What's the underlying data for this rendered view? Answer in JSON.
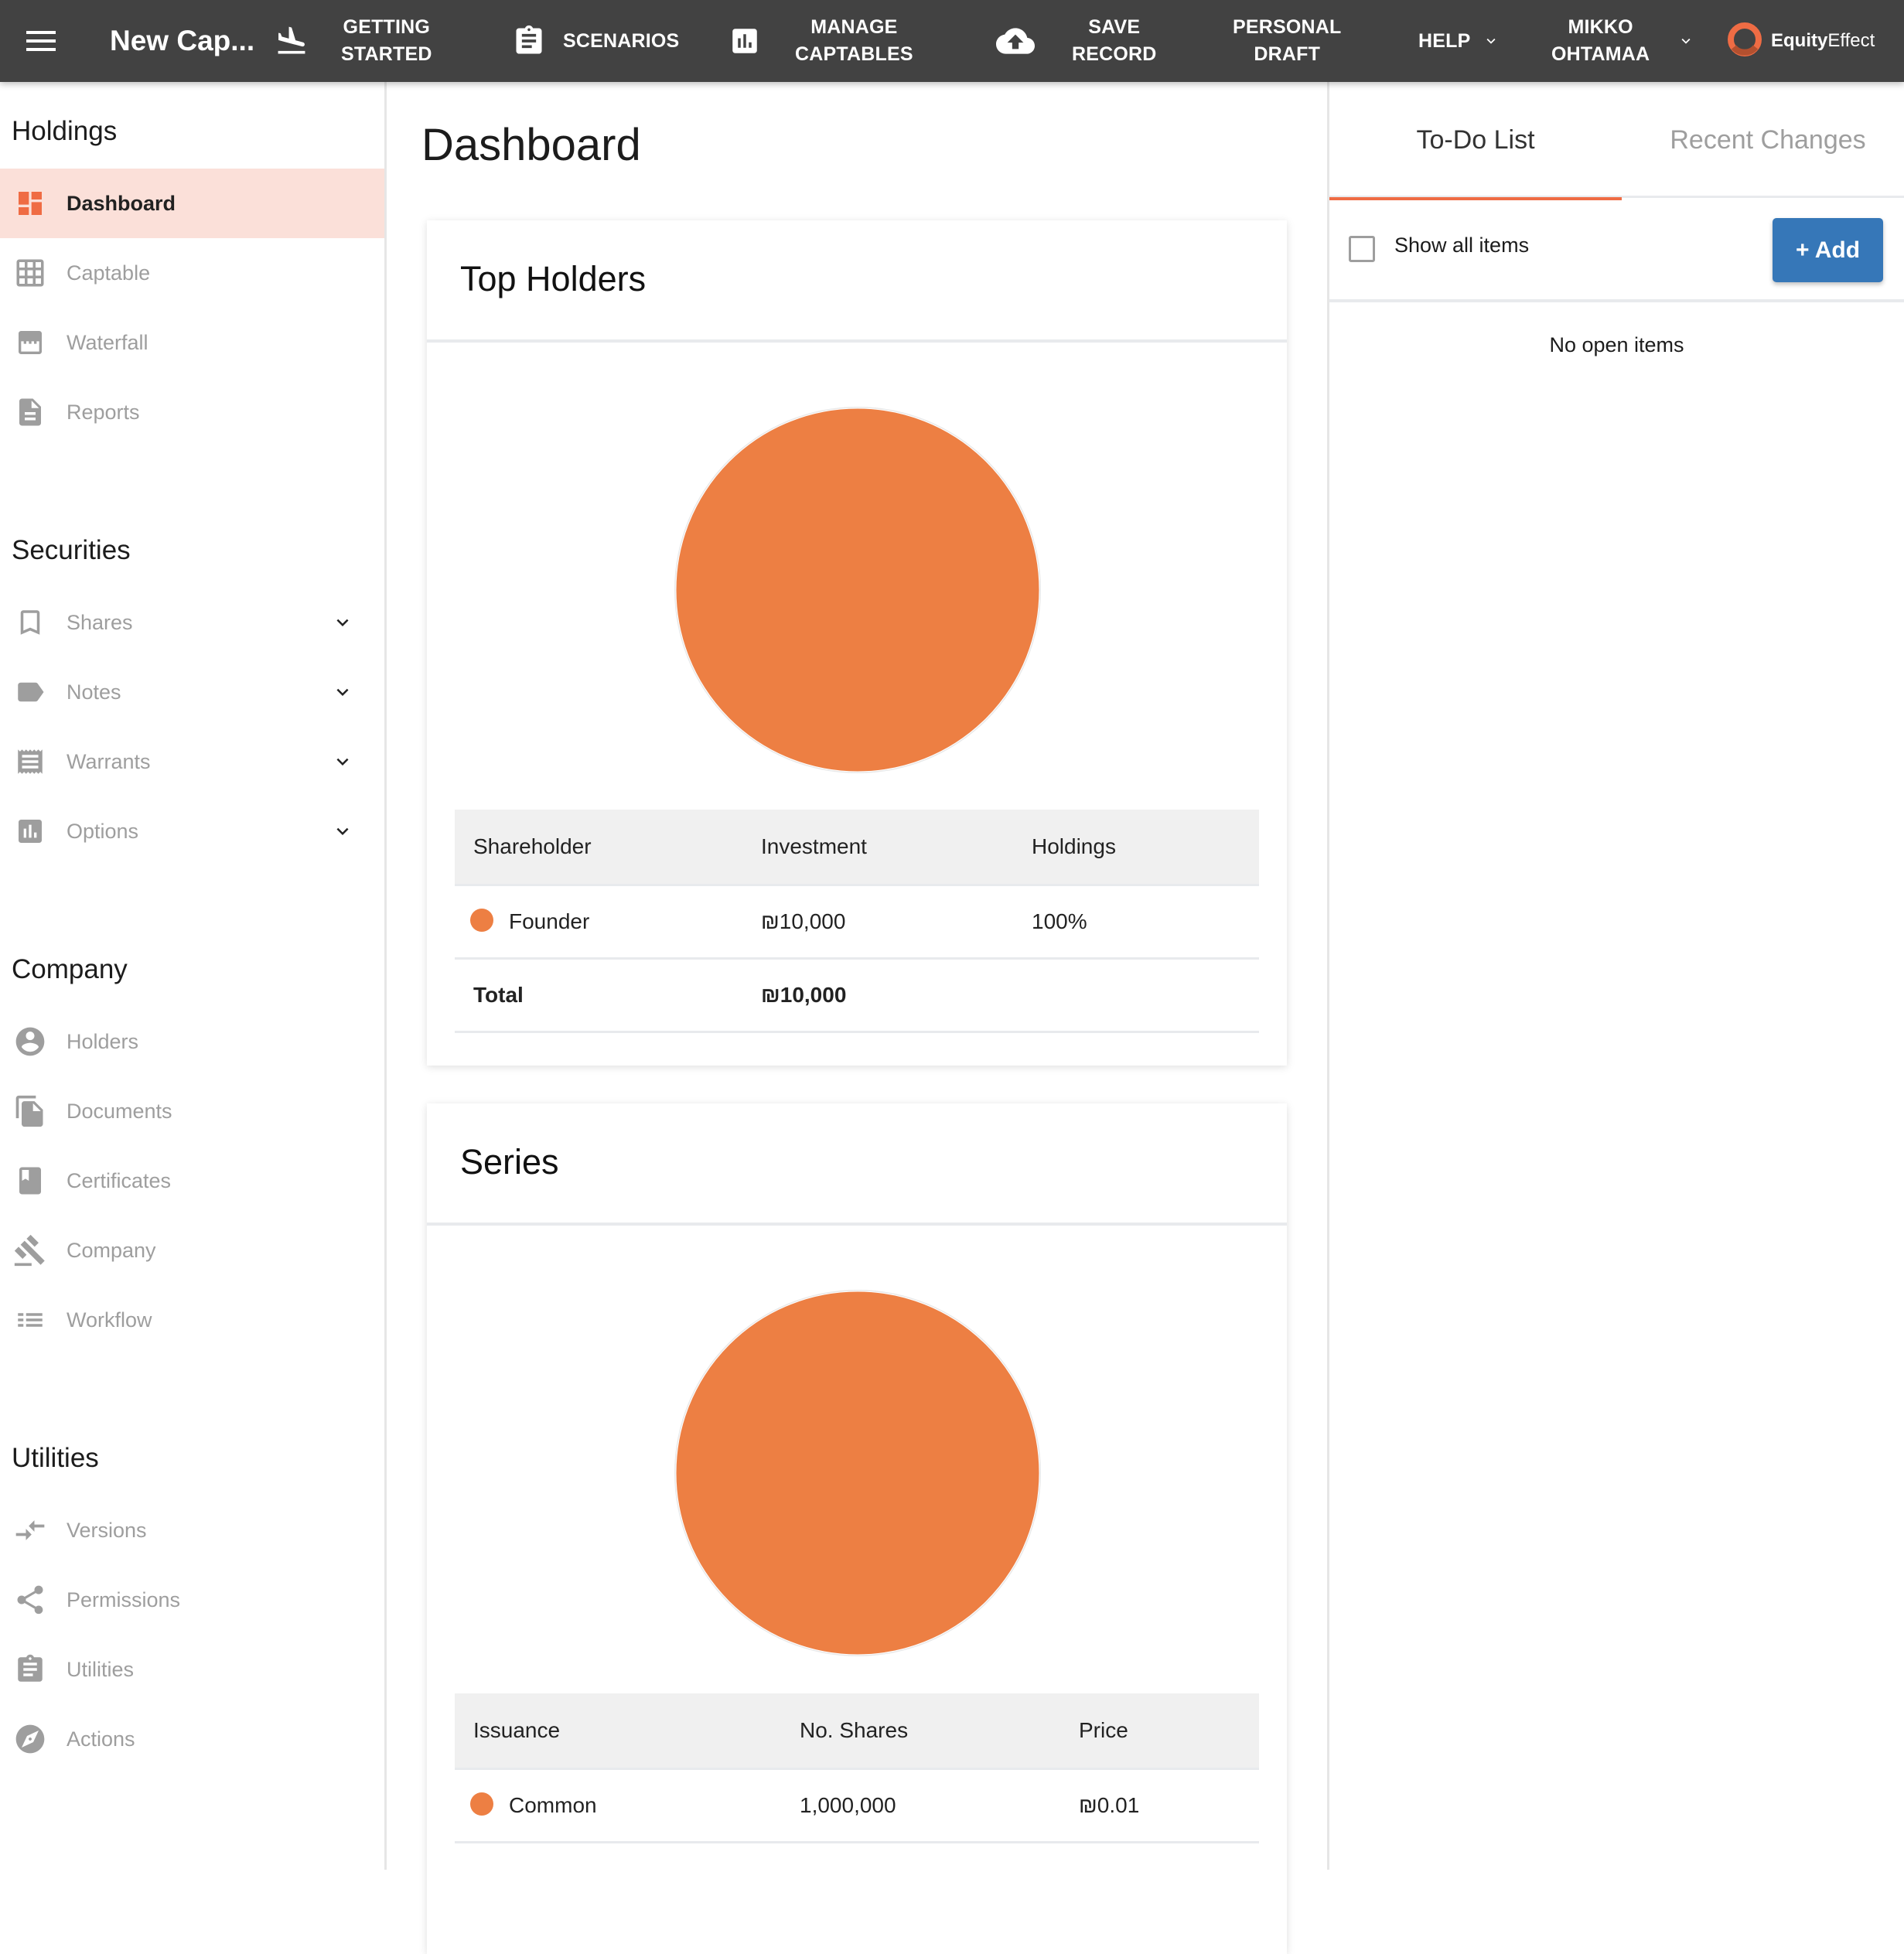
{
  "topbar": {
    "app_title": "New Cap...",
    "nav": [
      {
        "label": "GETTING\nSTARTED",
        "icon": "flight-land-icon"
      },
      {
        "label": "SCENARIOS",
        "icon": "clipboard-icon"
      },
      {
        "label": "MANAGE\nCAPTABLES",
        "icon": "bar-chart-icon"
      },
      {
        "label": "SAVE\nRECORD",
        "icon": "cloud-upload-icon"
      },
      {
        "label": "PERSONAL\nDRAFT"
      },
      {
        "label": "HELP",
        "icon": "chevron-down-icon"
      },
      {
        "label": "MIKKO\nOHTAMAA",
        "icon": "chevron-down-icon"
      }
    ],
    "logo": {
      "bold": "Equity",
      "light": "Effect",
      "color": "#ef6c44"
    }
  },
  "sidebar": {
    "sections": [
      {
        "title": "Holdings",
        "items": [
          {
            "label": "Dashboard",
            "icon": "dashboard-icon",
            "active": true
          },
          {
            "label": "Captable",
            "icon": "grid-icon"
          },
          {
            "label": "Waterfall",
            "icon": "waterfall-icon"
          },
          {
            "label": "Reports",
            "icon": "document-icon"
          }
        ]
      },
      {
        "title": "Securities",
        "items": [
          {
            "label": "Shares",
            "icon": "bookmark-icon",
            "expandable": true
          },
          {
            "label": "Notes",
            "icon": "label-icon",
            "expandable": true
          },
          {
            "label": "Warrants",
            "icon": "receipt-icon",
            "expandable": true
          },
          {
            "label": "Options",
            "icon": "bar-chart-icon",
            "expandable": true
          }
        ]
      },
      {
        "title": "Company",
        "items": [
          {
            "label": "Holders",
            "icon": "account-circle-icon"
          },
          {
            "label": "Documents",
            "icon": "file-copy-icon"
          },
          {
            "label": "Certificates",
            "icon": "book-icon"
          },
          {
            "label": "Company",
            "icon": "gavel-icon"
          },
          {
            "label": "Workflow",
            "icon": "list-icon"
          }
        ]
      },
      {
        "title": "Utilities",
        "items": [
          {
            "label": "Versions",
            "icon": "compare-arrows-icon"
          },
          {
            "label": "Permissions",
            "icon": "share-icon"
          },
          {
            "label": "Utilities",
            "icon": "assignment-icon"
          },
          {
            "label": "Actions",
            "icon": "compass-icon"
          }
        ]
      }
    ]
  },
  "main": {
    "page_title": "Dashboard",
    "top_holders": {
      "title": "Top Holders",
      "columns": [
        "Shareholder",
        "Investment",
        "Holdings"
      ],
      "rows": [
        {
          "name": "Founder",
          "investment": "₪10,000",
          "holdings": "100%",
          "color": "#ed7f43"
        }
      ],
      "total": {
        "label": "Total",
        "investment": "₪10,000"
      }
    },
    "series": {
      "title": "Series",
      "columns": [
        "Issuance",
        "No. Shares",
        "Price"
      ],
      "rows": [
        {
          "name": "Common",
          "shares": "1,000,000",
          "price": "₪0.01",
          "color": "#ed7f43"
        }
      ]
    }
  },
  "right_panel": {
    "tabs": [
      {
        "label": "To-Do List",
        "active": true
      },
      {
        "label": "Recent Changes",
        "active": false
      }
    ],
    "show_all_label": "Show all items",
    "show_all_checked": false,
    "add_label": "+ Add",
    "empty_message": "No open items"
  },
  "chart_data": [
    {
      "type": "pie",
      "title": "Top Holders",
      "categories": [
        "Founder"
      ],
      "values": [
        100
      ],
      "unit": "%",
      "colors": [
        "#ed7f43"
      ]
    },
    {
      "type": "pie",
      "title": "Series",
      "categories": [
        "Common"
      ],
      "values": [
        1000000
      ],
      "colors": [
        "#ed7f43"
      ]
    }
  ]
}
